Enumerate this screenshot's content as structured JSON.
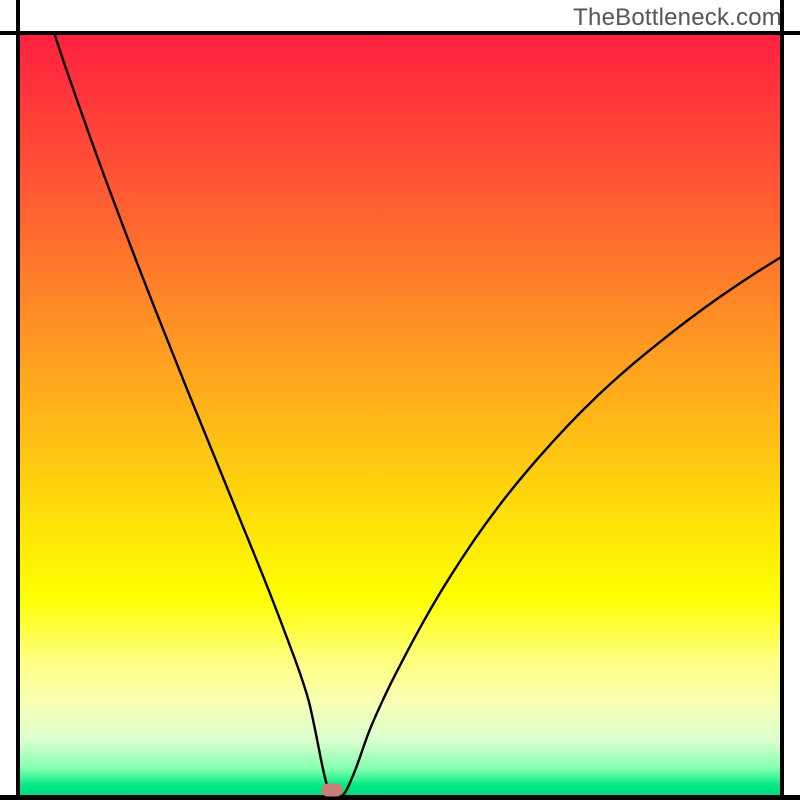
{
  "watermark": "TheBottleneck.com",
  "chart_data": {
    "type": "line",
    "title": "",
    "xlabel": "",
    "ylabel": "",
    "xlim": [
      0,
      100
    ],
    "ylim": [
      0,
      100
    ],
    "grid": false,
    "legend": false,
    "background": {
      "kind": "vertical-gradient",
      "stops": [
        {
          "pos": 0,
          "color": "#ff203f"
        },
        {
          "pos": 0.18,
          "color": "#ff5136"
        },
        {
          "pos": 0.45,
          "color": "#ffa61e"
        },
        {
          "pos": 0.65,
          "color": "#ffe409"
        },
        {
          "pos": 0.74,
          "color": "#ffff00"
        },
        {
          "pos": 0.82,
          "color": "#ffff7c"
        },
        {
          "pos": 0.88,
          "color": "#f8ffb7"
        },
        {
          "pos": 0.93,
          "color": "#d8ffcf"
        },
        {
          "pos": 0.965,
          "color": "#85ffb0"
        },
        {
          "pos": 0.988,
          "color": "#00e982"
        },
        {
          "pos": 1.0,
          "color": "#00da82"
        }
      ]
    },
    "series": [
      {
        "name": "bottleneck-curve",
        "color": "#000000",
        "x": [
          4.5,
          6,
          8,
          10,
          12,
          14,
          16,
          18,
          20,
          22,
          24,
          26,
          28,
          30,
          32,
          34,
          36,
          37,
          38,
          38.8,
          40.2,
          41.2,
          42.5,
          44,
          46,
          48,
          50,
          53,
          56,
          60,
          64,
          68,
          72,
          76,
          80,
          84,
          88,
          92,
          96,
          100
        ],
        "y": [
          100,
          95.5,
          89.8,
          84.2,
          78.8,
          73.5,
          68.3,
          63.2,
          58.2,
          53.2,
          48.3,
          43.4,
          38.5,
          33.6,
          28.7,
          23.6,
          18.3,
          15.5,
          12.3,
          8.7,
          2.0,
          0.0,
          0.0,
          3.0,
          8.5,
          13.0,
          17.0,
          22.6,
          27.7,
          33.8,
          39.2,
          44.0,
          48.4,
          52.4,
          56.0,
          59.3,
          62.4,
          65.3,
          68.0,
          70.5
        ]
      }
    ],
    "marker": {
      "x": 41,
      "y": 0.7,
      "color": "#cb7e78"
    }
  }
}
